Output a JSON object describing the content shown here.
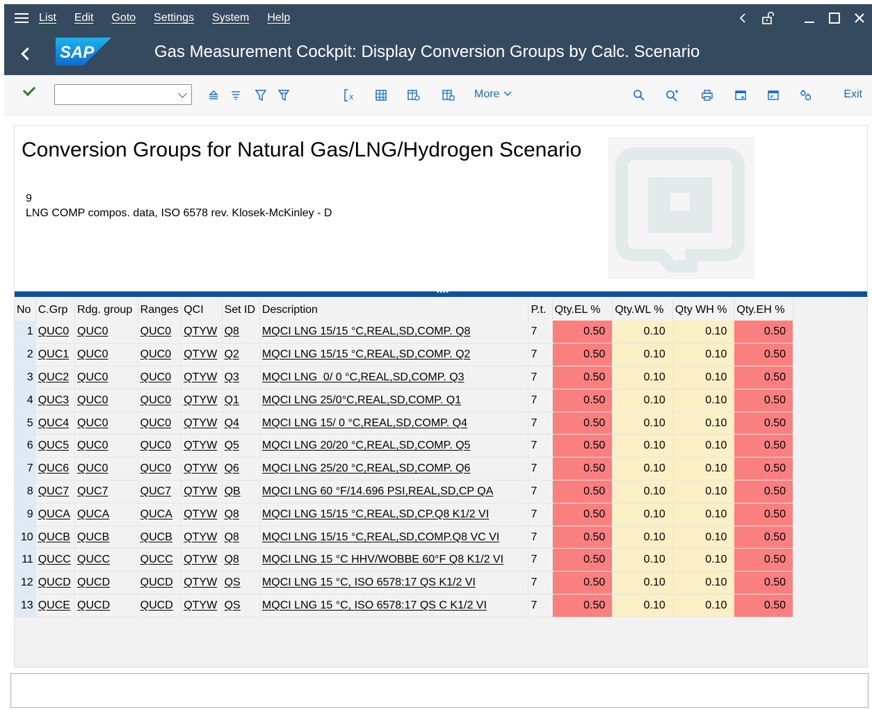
{
  "menubar": {
    "items": [
      "List",
      "Edit",
      "Goto",
      "Settings",
      "System",
      "Help"
    ],
    "right_icons": [
      "chevron-left-icon",
      "unlock-icon",
      "minimize-icon",
      "maximize-icon",
      "close-icon"
    ]
  },
  "titlebar": {
    "logo_text": "SAP",
    "title": "Gas Measurement Cockpit: Display Conversion Groups by Calc. Scenario"
  },
  "toolbar": {
    "more_label": "More",
    "exit_label": "Exit",
    "command_value": ""
  },
  "report": {
    "title": "Conversion Groups for Natural Gas/LNG/Hydrogen Scenario",
    "scenario_no": "9",
    "scenario_desc": "LNG COMP compos. data, ISO 6578 rev. Klosek-McKinley - D"
  },
  "table": {
    "columns": [
      "No",
      "C.Grp",
      "Rdg. group",
      "Ranges",
      "QCI",
      "Set ID",
      "Description",
      "P.t.",
      "Qty.EL %",
      "Qty.WL %",
      "Qty WH %",
      "Qty.EH %"
    ],
    "rows": [
      [
        "1",
        "QUC0",
        "QUC0",
        "QUC0",
        "QTYW",
        "Q8",
        "MQCI LNG 15/15 °C,REAL,SD,COMP. Q8",
        "7",
        "0.50",
        "0.10",
        "0.10",
        "0.50"
      ],
      [
        "2",
        "QUC1",
        "QUC0",
        "QUC0",
        "QTYW",
        "Q2",
        "MQCI LNG 15/15 °C,REAL,SD,COMP. Q2",
        "7",
        "0.50",
        "0.10",
        "0.10",
        "0.50"
      ],
      [
        "3",
        "QUC2",
        "QUC0",
        "QUC0",
        "QTYW",
        "Q3",
        "MQCI LNG  0/ 0 °C,REAL,SD,COMP. Q3",
        "7",
        "0.50",
        "0.10",
        "0.10",
        "0.50"
      ],
      [
        "4",
        "QUC3",
        "QUC0",
        "QUC0",
        "QTYW",
        "Q1",
        "MQCI LNG 25/0°C,REAL,SD,COMP. Q1",
        "7",
        "0.50",
        "0.10",
        "0.10",
        "0.50"
      ],
      [
        "5",
        "QUC4",
        "QUC0",
        "QUC0",
        "QTYW",
        "Q4",
        "MQCI LNG 15/ 0 °C,REAL,SD,COMP. Q4",
        "7",
        "0.50",
        "0.10",
        "0.10",
        "0.50"
      ],
      [
        "6",
        "QUC5",
        "QUC0",
        "QUC0",
        "QTYW",
        "Q5",
        "MQCI LNG 20/20 °C,REAL,SD,COMP. Q5",
        "7",
        "0.50",
        "0.10",
        "0.10",
        "0.50"
      ],
      [
        "7",
        "QUC6",
        "QUC0",
        "QUC0",
        "QTYW",
        "Q6",
        "MQCI LNG 25/20 °C,REAL,SD,COMP. Q6",
        "7",
        "0.50",
        "0.10",
        "0.10",
        "0.50"
      ],
      [
        "8",
        "QUC7",
        "QUC7",
        "QUC7",
        "QTYW",
        "QB",
        "MQCI LNG 60 °F/14.696 PSI,REAL,SD,CP QA",
        "7",
        "0.50",
        "0.10",
        "0.10",
        "0.50"
      ],
      [
        "9",
        "QUCA",
        "QUCA",
        "QUCA",
        "QTYW",
        "Q8",
        "MQCI LNG 15/15 °C,REAL,SD,CP.Q8 K1/2 VI",
        "7",
        "0.50",
        "0.10",
        "0.10",
        "0.50"
      ],
      [
        "10",
        "QUCB",
        "QUCB",
        "QUCB",
        "QTYW",
        "Q8",
        "MQCI LNG 15/15 °C,REAL,SD,COMP.Q8 VC VI",
        "7",
        "0.50",
        "0.10",
        "0.10",
        "0.50"
      ],
      [
        "11",
        "QUCC",
        "QUCC",
        "QUCC",
        "QTYW",
        "Q8",
        "MQCI LNG 15 °C HHV/WOBBE 60°F Q8 K1/2 VI",
        "7",
        "0.50",
        "0.10",
        "0.10",
        "0.50"
      ],
      [
        "12",
        "QUCD",
        "QUCD",
        "QUCD",
        "QTYW",
        "QS",
        "MQCI LNG 15 °C, ISO 6578:17 QS K1/2 VI",
        "7",
        "0.50",
        "0.10",
        "0.10",
        "0.50"
      ],
      [
        "13",
        "QUCE",
        "QUCD",
        "QUCD",
        "QTYW",
        "QS",
        "MQCI LNG 15 °C, ISO 6578:17 QS C K1/2 VI",
        "7",
        "0.50",
        "0.10",
        "0.10",
        "0.50"
      ]
    ]
  },
  "colors": {
    "shell": "#354a5f",
    "accent": "#0a6ed1",
    "splitter": "#0854a0",
    "el_eh_cell": "#fa8080",
    "wl_wh_cell": "#fbefc5"
  },
  "statusbar": {
    "message": ""
  }
}
